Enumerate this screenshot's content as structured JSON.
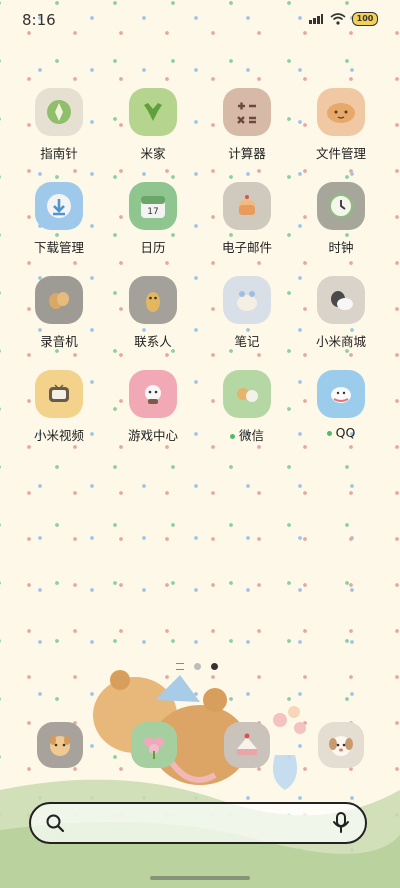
{
  "status_bar": {
    "time": "8:16",
    "battery": "100",
    "icons": [
      "network-speed-icon",
      "wifi-icon",
      "signal-icon",
      "battery-icon"
    ]
  },
  "apps": [
    {
      "label": "指南针",
      "icon": "compass-icon"
    },
    {
      "label": "米家",
      "icon": "mijia-icon"
    },
    {
      "label": "计算器",
      "icon": "calculator-icon"
    },
    {
      "label": "文件管理",
      "icon": "file-manager-icon"
    },
    {
      "label": "下载管理",
      "icon": "download-icon"
    },
    {
      "label": "日历",
      "icon": "calendar-icon",
      "date": "17"
    },
    {
      "label": "电子邮件",
      "icon": "email-icon"
    },
    {
      "label": "时钟",
      "icon": "clock-icon"
    },
    {
      "label": "录音机",
      "icon": "recorder-icon"
    },
    {
      "label": "联系人",
      "icon": "contacts-icon"
    },
    {
      "label": "笔记",
      "icon": "notes-icon"
    },
    {
      "label": "小米商城",
      "icon": "mi-store-icon"
    },
    {
      "label": "小米视频",
      "icon": "mi-video-icon"
    },
    {
      "label": "游戏中心",
      "icon": "game-center-icon"
    },
    {
      "label": "微信",
      "icon": "wechat-icon",
      "notification_dot": true
    },
    {
      "label": "QQ",
      "icon": "qq-icon",
      "notification_dot": true
    }
  ],
  "page_indicator": {
    "pages": 2,
    "active": 2
  },
  "dock": [
    "dock-dog-icon",
    "dock-flower-icon",
    "dock-cake-icon",
    "dock-puppy-icon"
  ],
  "search": {
    "label": "search"
  },
  "colors": {
    "background": "#fdf8e8",
    "dot_green": "#4fbc6b"
  }
}
